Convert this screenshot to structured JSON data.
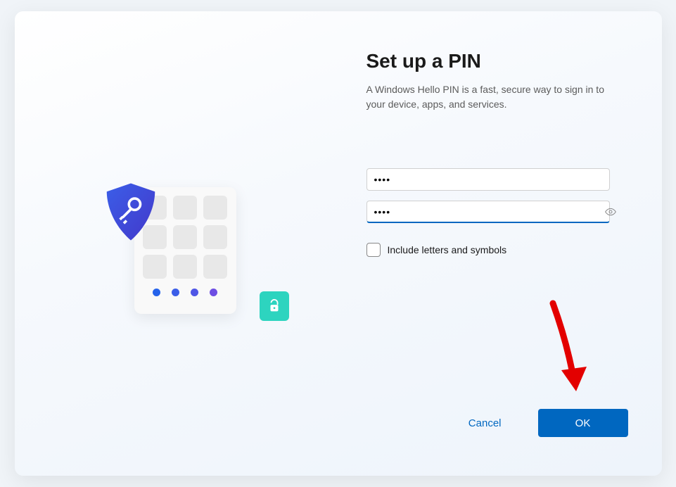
{
  "dialog": {
    "title": "Set up a PIN",
    "subtitle": "A Windows Hello PIN is a fast, secure way to sign in to your device, apps, and services.",
    "pin_value": "••••",
    "confirm_pin_value": "••••",
    "checkbox_label": "Include letters and symbols",
    "checkbox_checked": false,
    "cancel_label": "Cancel",
    "ok_label": "OK"
  },
  "colors": {
    "accent": "#0067c0",
    "teal": "#2dd4bf",
    "arrow": "#e30000"
  }
}
